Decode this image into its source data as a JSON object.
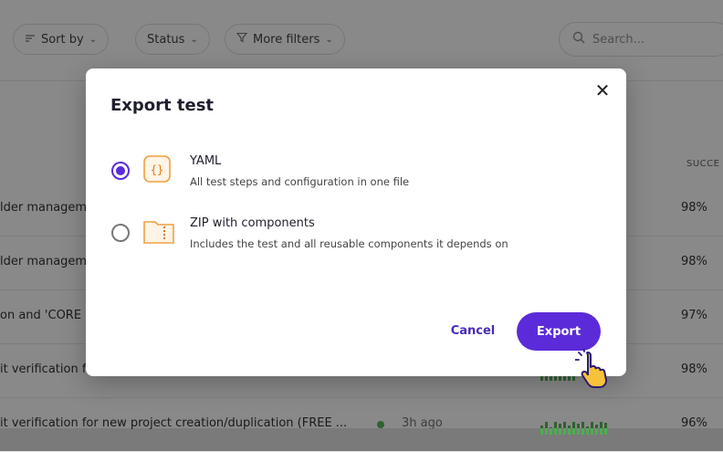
{
  "toolbar": {
    "sort_label": "Sort by",
    "status_label": "Status",
    "more_filters_label": "More filters",
    "search_placeholder": "Search..."
  },
  "table": {
    "success_header": "SUCCE",
    "rows": [
      {
        "name": "lder managem",
        "success": "98%"
      },
      {
        "name": "lder managem",
        "success": "98%"
      },
      {
        "name": "on and 'CORE",
        "success": "97%"
      },
      {
        "name": "it verification f",
        "success": "98%"
      },
      {
        "name": "it verification for new project creation/duplication (FREE ...",
        "success": "96%",
        "last_run": "3h ago"
      }
    ]
  },
  "modal": {
    "title": "Export test",
    "options": [
      {
        "title": "YAML",
        "description": "All test steps and configuration in one file",
        "selected": true
      },
      {
        "title": "ZIP with components",
        "description": "Includes the test and all reusable components it depends on",
        "selected": false
      }
    ],
    "cancel_label": "Cancel",
    "export_label": "Export"
  },
  "colors": {
    "accent": "#5b2bd9",
    "icon_orange": "#f0a040",
    "success_green": "#4caf50"
  }
}
